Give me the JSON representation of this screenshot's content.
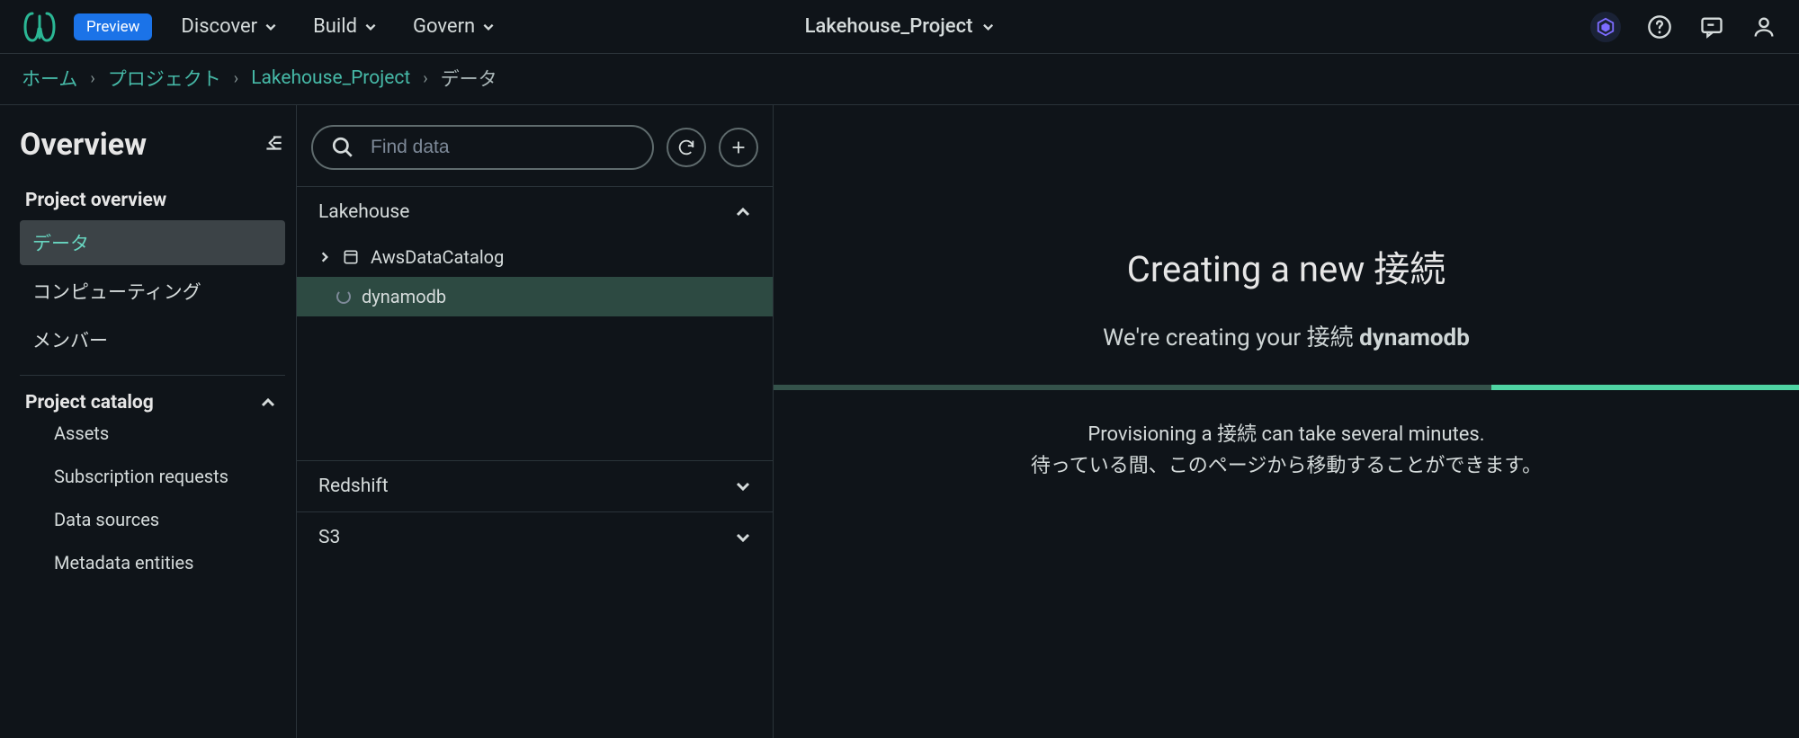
{
  "topnav": {
    "preview_badge": "Preview",
    "items": [
      {
        "label": "Discover"
      },
      {
        "label": "Build"
      },
      {
        "label": "Govern"
      }
    ],
    "project_selector": "Lakehouse_Project"
  },
  "breadcrumb": {
    "items": [
      {
        "label": "ホーム",
        "link": true
      },
      {
        "label": "プロジェクト",
        "link": true
      },
      {
        "label": "Lakehouse_Project",
        "link": true
      },
      {
        "label": "データ",
        "link": false
      }
    ]
  },
  "sidebar": {
    "title": "Overview",
    "overview_header": "Project overview",
    "overview_items": [
      {
        "label": "データ",
        "active": true
      },
      {
        "label": "コンピューティング",
        "active": false
      },
      {
        "label": "メンバー",
        "active": false
      }
    ],
    "catalog_header": "Project catalog",
    "catalog_items": [
      {
        "label": "Assets"
      },
      {
        "label": "Subscription requests"
      },
      {
        "label": "Data sources"
      },
      {
        "label": "Metadata entities"
      }
    ]
  },
  "midpanel": {
    "search_placeholder": "Find data",
    "groups": [
      {
        "name": "Lakehouse",
        "expanded": true,
        "children": [
          {
            "name": "AwsDataCatalog",
            "icon": "catalog",
            "expandable": true,
            "selected": false,
            "loading": false
          },
          {
            "name": "dynamodb",
            "icon": "loading",
            "expandable": false,
            "selected": true,
            "loading": true
          }
        ]
      },
      {
        "name": "Redshift",
        "expanded": false,
        "children": []
      },
      {
        "name": "S3",
        "expanded": false,
        "children": []
      }
    ]
  },
  "rightpane": {
    "title": "Creating a new 接続",
    "subtitle_prefix": "We're creating your 接続 ",
    "subtitle_bold": "dynamodb",
    "desc_line1": "Provisioning a 接続 can take several minutes.",
    "desc_line2": "待っている間、このページから移動することができます。"
  }
}
